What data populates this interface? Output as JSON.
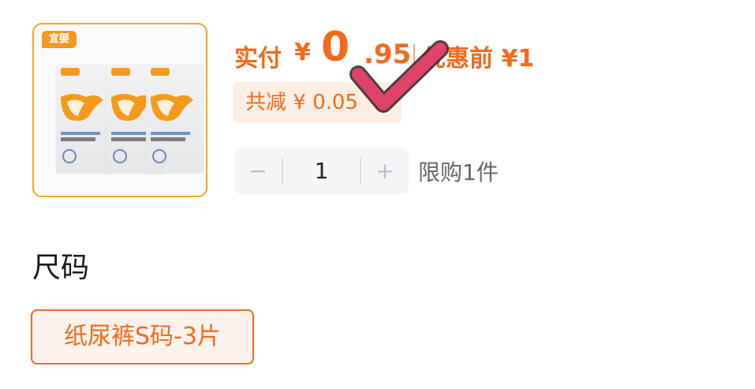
{
  "product": {
    "image_alt": "diaper packs",
    "brand_badge": "宜婴",
    "packs": [
      {
        "label": "宜婴"
      },
      {
        "label": "宜婴"
      },
      {
        "label": "宜婴"
      }
    ]
  },
  "price": {
    "paid_label": "实付",
    "currency": "¥",
    "integer": "0",
    "decimal": ".95",
    "original": "优惠前 ¥1",
    "accent_color": "#f26b1d"
  },
  "discount": {
    "label": "共减 ¥ 0.05"
  },
  "quantity": {
    "minus": "−",
    "value": "1",
    "plus": "+",
    "limit_text": "限购1件"
  },
  "size": {
    "title": "尺码",
    "options": [
      {
        "label": "纸尿裤S码-3片",
        "selected": true
      }
    ]
  },
  "overlay": {
    "icon": "checkmark-icon",
    "color": "#e0436a"
  }
}
